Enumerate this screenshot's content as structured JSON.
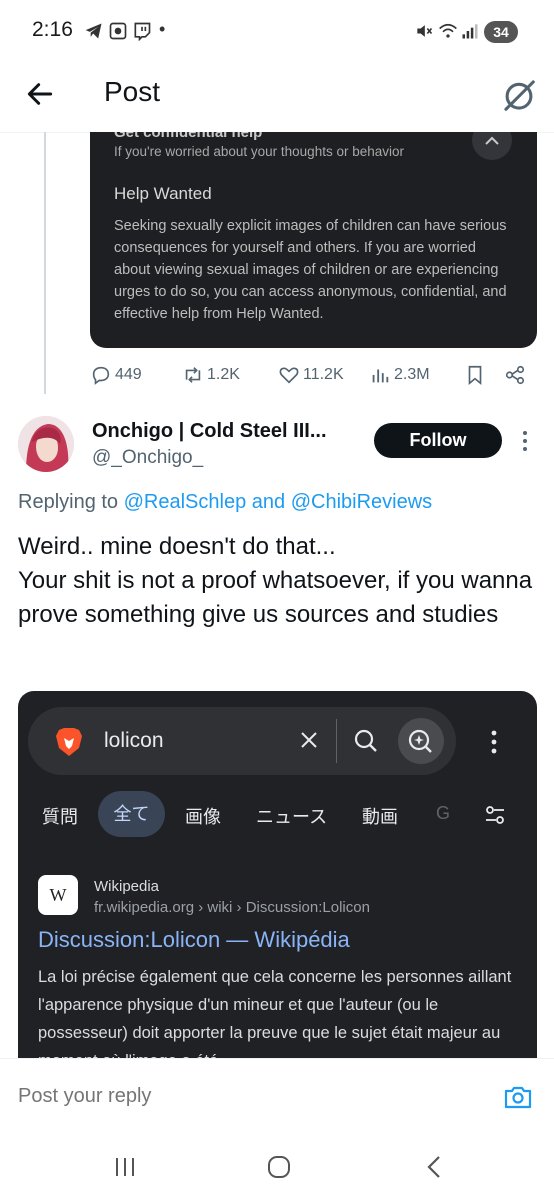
{
  "status_bar": {
    "time": "2:16",
    "dot": "•",
    "battery": "34",
    "left_icons": [
      "telegram-icon",
      "screenshot-icon",
      "twitch-icon"
    ],
    "right_icons": [
      "mute-icon",
      "wifi-icon",
      "signal-icon"
    ]
  },
  "header": {
    "title": "Post",
    "back_icon": "arrow-left-icon",
    "grok_icon": "grok-icon"
  },
  "embedded_card": {
    "heading_cut": "Get confidential help",
    "subtitle": "If you're worried about your thoughts or behavior",
    "help_title": "Help Wanted",
    "help_body": "Seeking sexually explicit images of children can have serious consequences for yourself and others. If you are worried about viewing sexual images of children or are experiencing urges to do so, you can access anonymous, confidential, and effective help from Help Wanted."
  },
  "actions": {
    "replies": "449",
    "reposts": "1.2K",
    "likes": "11.2K",
    "views": "2.3M"
  },
  "reply_post": {
    "display_name": "Onchigo | Cold Steel III...",
    "handle": "@_Onchigo_",
    "follow_label": "Follow",
    "replying_prefix": "Replying to ",
    "replying_to": "@RealSchlep and @ChibiReviews",
    "text_line1": "Weird.. mine doesn't do that...",
    "text_line2": "Your shit is not a proof whatsoever, if you wanna prove something give us sources and studies"
  },
  "screenshot": {
    "query": "lolicon",
    "tabs": [
      "質問",
      "全て",
      "画像",
      "ニュース",
      "動画",
      "G"
    ],
    "active_tab": "全て",
    "result": {
      "badge": "W",
      "site_name": "Wikipedia",
      "url": "fr.wikipedia.org › wiki › Discussion:Lolicon",
      "title": "Discussion:Lolicon — Wikipédia",
      "snippet": "La loi précise également que cela concerne les personnes aillant l'apparence physique d'un mineur et que l'auteur (ou le possesseur) doit apporter la preuve que le sujet était majeur au moment où l'image a été"
    }
  },
  "reply_bar": {
    "placeholder": "Post your reply"
  },
  "colors": {
    "accent": "#1d9bf0",
    "text_primary": "#0f1419",
    "text_secondary": "#536471",
    "dark_card": "#202124",
    "link_blue_dark": "#8ab4f8"
  }
}
